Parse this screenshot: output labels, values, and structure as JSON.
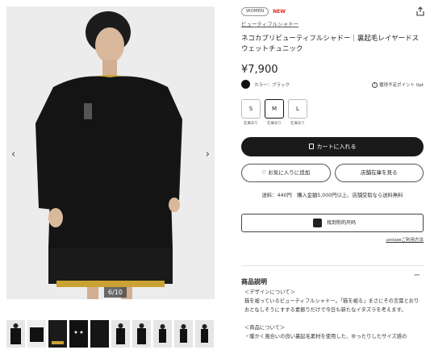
{
  "gallery": {
    "prev_arrow": "‹",
    "next_arrow": "›",
    "counter": "6/10",
    "thumbnails": [
      "thumb-1",
      "thumb-2",
      "thumb-3",
      "thumb-4",
      "thumb-5",
      "thumb-6",
      "thumb-7",
      "thumb-8",
      "thumb-9",
      "thumb-10"
    ]
  },
  "product": {
    "badge_women": "WOMEN",
    "badge_new": "NEW",
    "brand": "ビューティフルシャドー",
    "title": "ネコカブリビューティフルシャドー｜裏起毛レイヤードスウェットチュニック",
    "price": "¥7,900",
    "color_label": "カラー：ブラック",
    "points_text": "獲得予定ポイント 0pt",
    "color_swatch": "#111111"
  },
  "sizes": [
    {
      "label": "S",
      "stock": "在庫あり"
    },
    {
      "label": "M",
      "stock": "在庫あり"
    },
    {
      "label": "L",
      "stock": "在庫あり"
    }
  ],
  "actions": {
    "cart": "カートに入れる",
    "favorite": "お気に入りに追加",
    "store_stock": "店舗在庫を見る",
    "shipping": "送料：440円　購入金額5,000円以上、店舗受取なら送料無料",
    "payment": "找到你的尺码",
    "size_guide": "unisizeご利用方法"
  },
  "description": {
    "heading": "商品説明",
    "toggle": "−",
    "line1": "＜デザインについて＞",
    "line2": "猫を被っているビューティフルシャドー。「猫を被る」まさにその言葉とおり",
    "line3": "おとなしそうにすする素振りだけで今日も新たなイタズラを考えます。",
    "line4": "＜商品について＞",
    "line5": "・暖かく風合いの良い裏起毛素材を使用した、ゆったりしたサイズ感の"
  },
  "colors": {
    "accent_dark": "#1a1a1a",
    "new_red": "#e2231a"
  }
}
